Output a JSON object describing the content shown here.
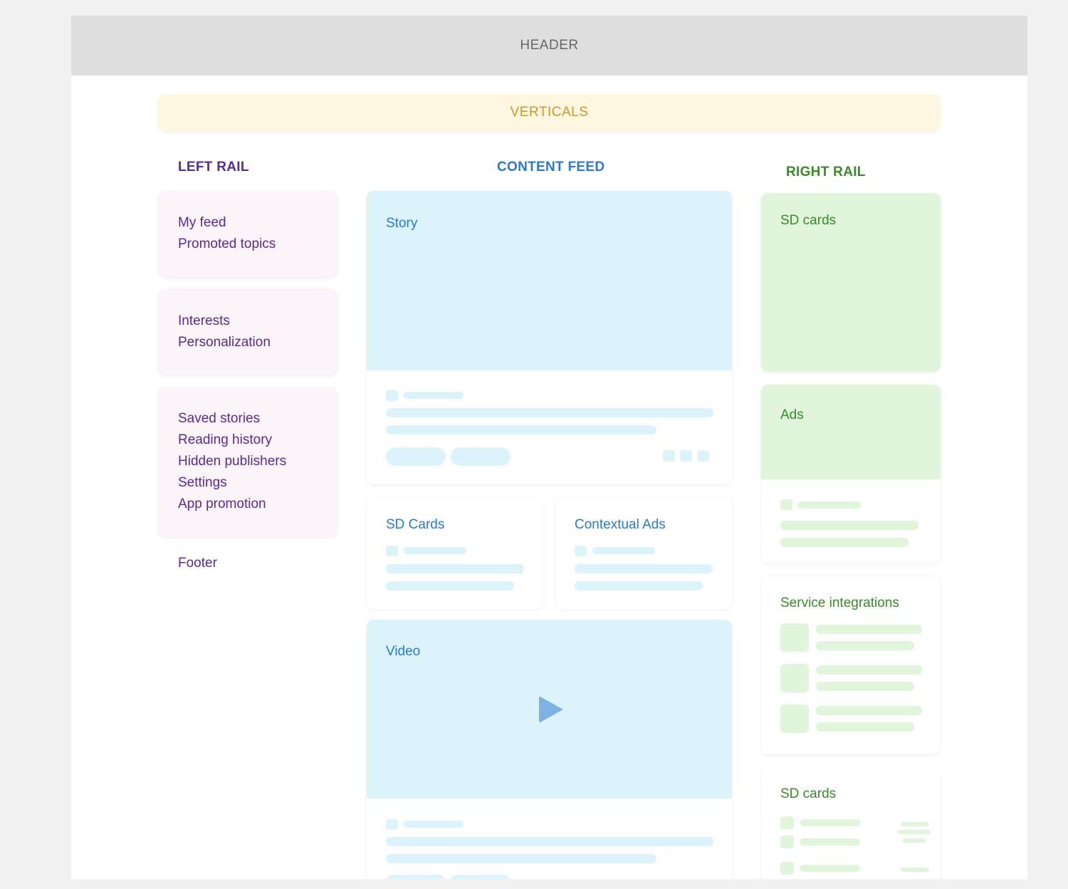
{
  "header": {
    "label": "HEADER"
  },
  "verticals": {
    "label": "VERTICALS"
  },
  "left_rail": {
    "title": "LEFT RAIL",
    "groups": [
      [
        "My feed",
        "Promoted topics"
      ],
      [
        "Interests",
        "Personalization"
      ],
      [
        "Saved stories",
        "Reading history",
        "Hidden publishers",
        "Settings",
        "App promotion"
      ]
    ],
    "footer": "Footer"
  },
  "content_feed": {
    "title": "CONTENT FEED",
    "story": "Story",
    "sd_cards": "SD Cards",
    "contextual_ads": "Contextual Ads",
    "video": "Video"
  },
  "right_rail": {
    "title": "RIGHT RAIL",
    "sd_cards_top": "SD cards",
    "ads": "Ads",
    "service_integrations": "Service integrations",
    "sd_cards_bottom": "SD cards"
  },
  "colors": {
    "header_bg": "#dedede",
    "verticals_bg": "#fdf6e0",
    "left_rail_accent": "#5a2a8e",
    "content_feed_accent": "#2a79cd",
    "right_rail_accent": "#3a8a2a"
  },
  "icons": {
    "video_play": "play-icon"
  }
}
